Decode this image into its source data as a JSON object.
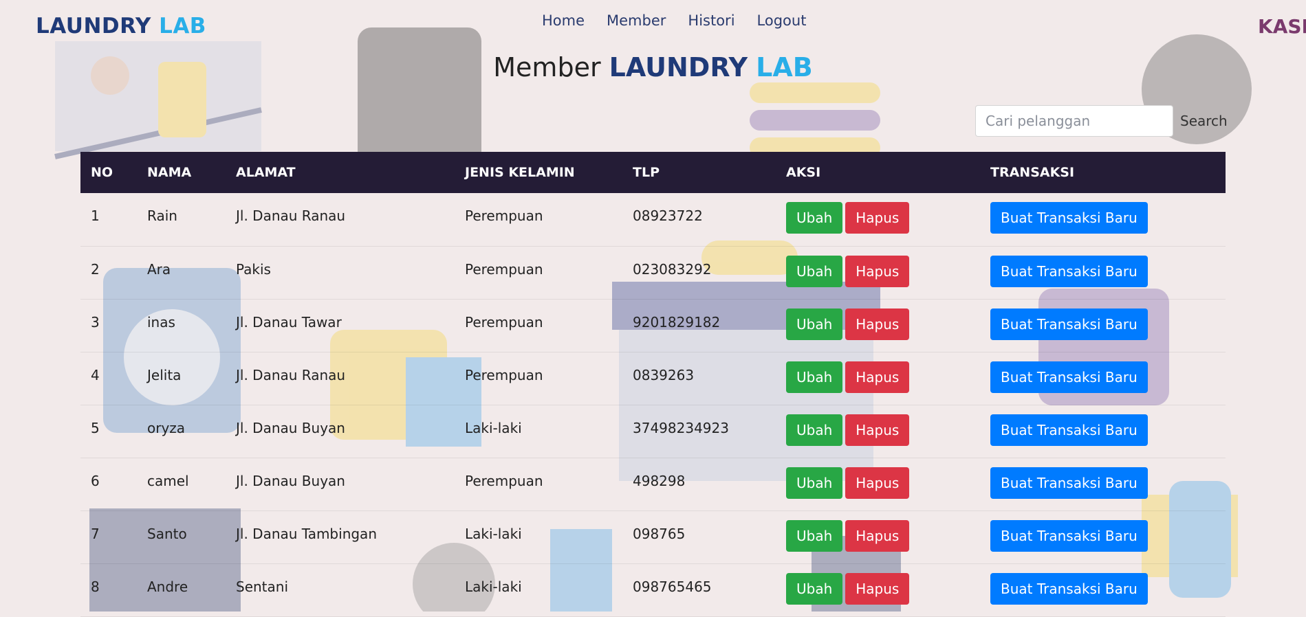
{
  "brand": {
    "part1": "LAUNDRY",
    "part2": "LAB"
  },
  "nav": [
    "Home",
    "Member",
    "Histori",
    "Logout"
  ],
  "role_label": "KASIR",
  "title": {
    "prefix": "Member",
    "brand1": "LAUNDRY",
    "brand2": "LAB"
  },
  "search": {
    "placeholder": "Cari pelanggan",
    "button": "Search"
  },
  "table": {
    "headers": [
      "NO",
      "NAMA",
      "ALAMAT",
      "JENIS KELAMIN",
      "TLP",
      "AKSI",
      "TRANSAKSI"
    ],
    "rows": [
      {
        "no": "1",
        "nama": "Rain",
        "alamat": "Jl. Danau Ranau",
        "jk": "Perempuan",
        "tlp": "08923722"
      },
      {
        "no": "2",
        "nama": "Ara",
        "alamat": "Pakis",
        "jk": "Perempuan",
        "tlp": "023083292"
      },
      {
        "no": "3",
        "nama": "inas",
        "alamat": "Jl. Danau Tawar",
        "jk": "Perempuan",
        "tlp": "9201829182"
      },
      {
        "no": "4",
        "nama": "Jelita",
        "alamat": "Jl. Danau Ranau",
        "jk": "Perempuan",
        "tlp": "0839263"
      },
      {
        "no": "5",
        "nama": "oryza",
        "alamat": "Jl. Danau Buyan",
        "jk": "Laki-laki",
        "tlp": "37498234923"
      },
      {
        "no": "6",
        "nama": "camel",
        "alamat": "Jl. Danau Buyan",
        "jk": "Perempuan",
        "tlp": "498298"
      },
      {
        "no": "7",
        "nama": "Santo",
        "alamat": "Jl. Danau Tambingan",
        "jk": "Laki-laki",
        "tlp": "098765"
      },
      {
        "no": "8",
        "nama": "Andre",
        "alamat": "Sentani",
        "jk": "Laki-laki",
        "tlp": "098765465"
      }
    ],
    "actions": {
      "edit": "Ubah",
      "delete": "Hapus",
      "transaction": "Buat Transaksi Baru"
    }
  },
  "colors": {
    "brand_dark": "#1f3a78",
    "brand_light": "#29aee8",
    "header_bg": "#241c36",
    "edit": "#28a745",
    "delete": "#dc3545",
    "transaction": "#007bff"
  }
}
